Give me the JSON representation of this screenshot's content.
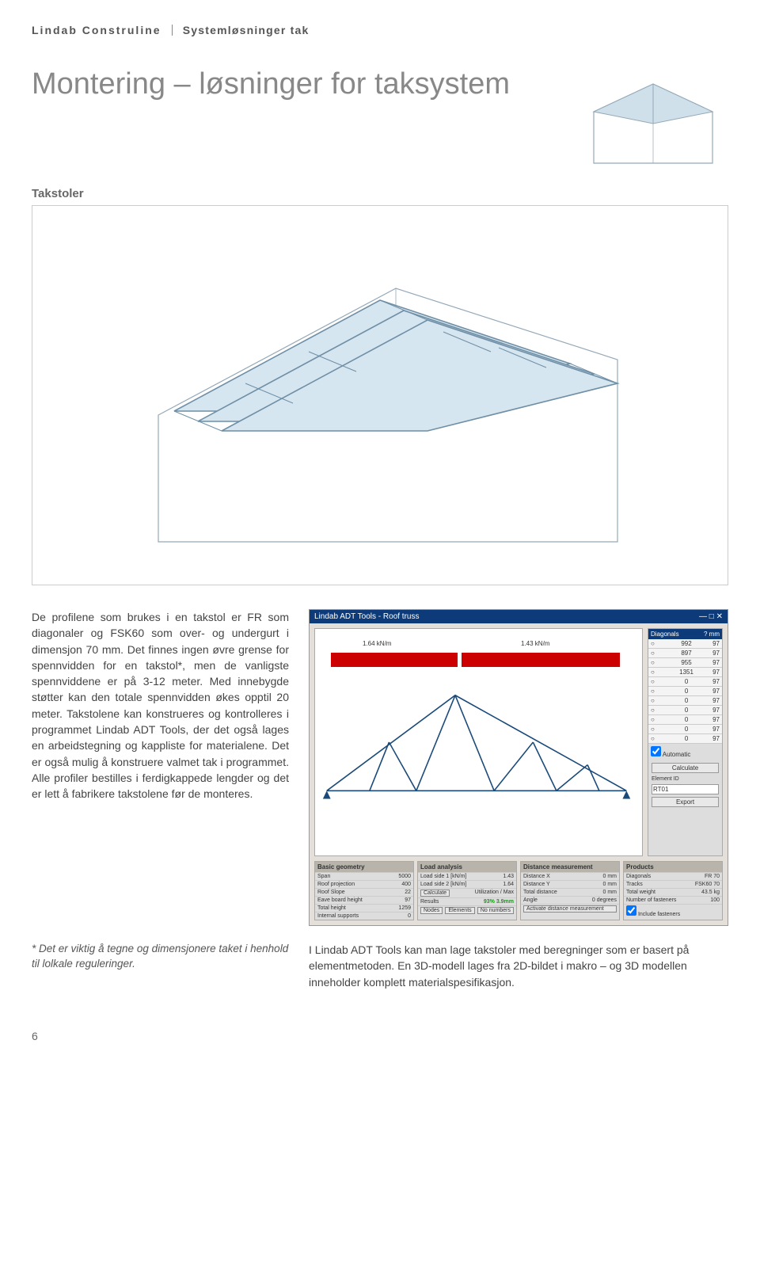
{
  "header": {
    "brand": "Lindab Construline",
    "section": "Systemløsninger tak"
  },
  "title": "Montering – løsninger for taksystem",
  "section_label": "Takstoler",
  "body_text": "De profilene som brukes i en takstol er FR som diagonaler og FSK60 som over- og undergurt i dimensjon 70 mm. Det finnes ingen øvre grense for spennvidden for en takstol*, men de vanligste spennviddene er på 3-12 meter. Med innebygde støtter kan den totale spennvidden økes opptil 20 meter. Takstolene kan konstrueres og kontrolleres i programmet Lindab ADT Tools, der det også lages en arbeidstegning og kappliste for materialene. Det er også mulig å konstruere valmet tak i programmet. Alle profiler bestilles i ferdigkappede lengder og det er lett å fabrikere takstolene før de monteres.",
  "footnote": "* Det er viktig å tegne og dimensjonere taket i henhold til lolkale reguleringer.",
  "caption": "I Lindab ADT Tools kan man lage takstoler med beregninger som er basert på elementmetoden. En 3D-modell lages fra 2D-bildet i makro – og 3D modellen inneholder komplett materialspesifikasjon.",
  "page_number": "6",
  "screenshot": {
    "title": "Lindab ADT Tools - Roof truss",
    "loads": {
      "left": "1.64 kN/m",
      "right": "1.43 kN/m"
    },
    "diagonals": {
      "header_left": "Diagonals",
      "header_right": "? mm",
      "rows": [
        [
          "",
          "992",
          "97"
        ],
        [
          "",
          "897",
          "97"
        ],
        [
          "",
          "955",
          "97"
        ],
        [
          "",
          "1351",
          "97"
        ],
        [
          "",
          "0",
          "97"
        ],
        [
          "",
          "0",
          "97"
        ],
        [
          "",
          "0",
          "97"
        ],
        [
          "",
          "0",
          "97"
        ],
        [
          "",
          "0",
          "97"
        ],
        [
          "",
          "0",
          "97"
        ],
        [
          "",
          "0",
          "97"
        ]
      ],
      "automatic_label": "Automatic",
      "calculate_btn": "Calculate",
      "element_id_label": "Element ID",
      "element_id_value": "RT01",
      "export_btn": "Export"
    },
    "panels": {
      "basic": {
        "title": "Basic geometry",
        "rows": [
          [
            "Span",
            "5000"
          ],
          [
            "Roof projection",
            "400"
          ],
          [
            "Roof Slope",
            "22"
          ],
          [
            "Eave board height",
            "97"
          ],
          [
            "Total height",
            "1259"
          ],
          [
            "Internal supports",
            "0"
          ]
        ]
      },
      "load": {
        "title": "Load analysis",
        "rows": [
          [
            "Load side 1 [kN/m]",
            "1.43"
          ],
          [
            "Load side 2 [kN/m]",
            "1.64"
          ]
        ],
        "calc_btn": "Calculate",
        "util_label": "Utilization / Max",
        "util_value": "93%  3.9mm",
        "nodes_btn": "Nodes",
        "elements_btn": "Elements",
        "nonum_btn": "No numbers"
      },
      "dist": {
        "title": "Distance measurement",
        "rows": [
          [
            "Distance X",
            "0",
            "mm"
          ],
          [
            "Distance Y",
            "0",
            "mm"
          ],
          [
            "Total distance",
            "0",
            "mm"
          ],
          [
            "Angle",
            "0",
            "degrees"
          ]
        ],
        "activate_btn": "Activate distance measurement"
      },
      "prod": {
        "title": "Products",
        "rows": [
          [
            "Diagonals",
            "FR 70"
          ],
          [
            "Tracks",
            "FSK60 70"
          ],
          [
            "Total weight",
            "43.5  kg"
          ],
          [
            "Number of fasteners",
            "100"
          ]
        ],
        "include_label": "Include fasteners"
      }
    }
  }
}
